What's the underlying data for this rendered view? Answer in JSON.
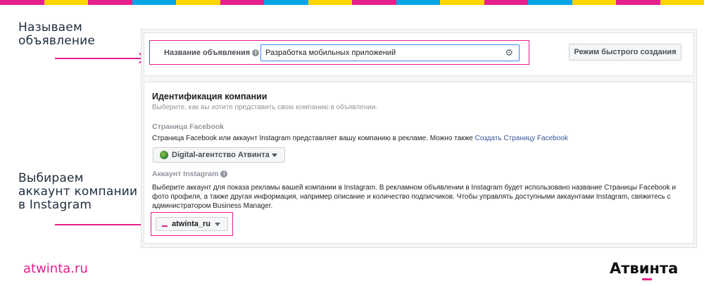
{
  "top_stripe_colors": [
    "#e51f8e",
    "#ffd400",
    "#e51f8e",
    "#00a6e6",
    "#ffd400",
    "#e51f8e",
    "#00a6e6",
    "#ffd400",
    "#e51f8e",
    "#00a6e6",
    "#ffd400",
    "#e51f8e",
    "#00a6e6",
    "#ffd400",
    "#e51f8e",
    "#ffd400"
  ],
  "accent_color": "#e51f8e",
  "annotations": {
    "name_ad": [
      "Называем",
      "объявление"
    ],
    "choose_account": [
      "Выбираем",
      "аккаунт компании",
      "в Instagram"
    ]
  },
  "ad_name": {
    "label": "Название объявления",
    "value": "Разработка мобильных приложений",
    "settings_icon": "gear-icon",
    "info_icon": "info-icon"
  },
  "quick_create_button": "Режим быстрого создания",
  "identity": {
    "title": "Идентификация компании",
    "subtitle": "Выберите, как вы хотите представить свою компанию в объявлении.",
    "facebook": {
      "heading": "Страница Facebook",
      "text": "Страница Facebook или аккаунт Instagram представляет вашу компанию в рекламе. Можно также ",
      "link": "Создать Страницу Facebook",
      "page_selected": "Digital-агентство Атвинта"
    },
    "instagram": {
      "heading": "Аккаунт Instagram",
      "text": "Выберите аккаунт для показа рекламы вашей компании в Instagram. В рекламном объявлении в Instagram будет использовано название Страницы Facebook и фото профиля, а также другая информация, например описание и количество подписчиков. Чтобы управлять доступными аккаунтами Instagram, свяжитесь с администратором Business Manager.",
      "account_selected": "atwinta_ru"
    }
  },
  "footer": {
    "site": "atwinta.ru",
    "logo_text": "Атвинта"
  }
}
